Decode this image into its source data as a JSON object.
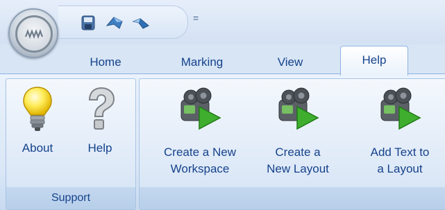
{
  "quick_access": {
    "buttons": [
      {
        "icon": "save-icon"
      },
      {
        "icon": "undo-icon"
      },
      {
        "icon": "redo-icon"
      }
    ],
    "more_icon": "chevron-down-icon",
    "more_glyph": "="
  },
  "tabs": [
    {
      "label": "Home",
      "active": false
    },
    {
      "label": "Marking",
      "active": false
    },
    {
      "label": "View",
      "active": false
    },
    {
      "label": "Help",
      "active": true
    }
  ],
  "ribbon": {
    "support_group": {
      "label": "Support",
      "buttons": [
        {
          "label": "About",
          "icon": "lightbulb-icon"
        },
        {
          "label": "Help",
          "icon": "question-mark-icon"
        }
      ]
    },
    "tutorials_group": {
      "buttons": [
        {
          "line1": "Create a New",
          "line2": "Workspace",
          "icon": "video-camera-play-icon"
        },
        {
          "line1": "Create a",
          "line2": "New Layout",
          "icon": "video-camera-play-icon"
        },
        {
          "line1": "Add Text to",
          "line2": "a Layout",
          "icon": "video-camera-play-icon"
        }
      ]
    }
  },
  "colors": {
    "text": "#15428b",
    "ribbon_border": "#8db2e3",
    "group_label_bg": "#c4d8ef",
    "play_green": "#3fae2e"
  }
}
